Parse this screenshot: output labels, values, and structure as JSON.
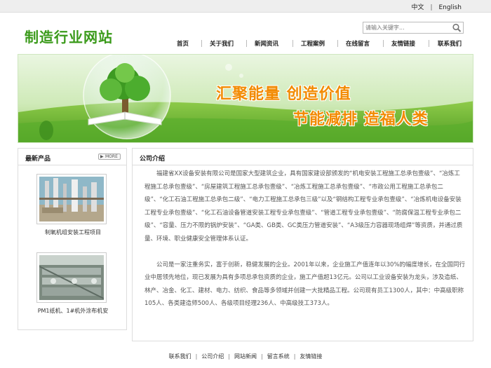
{
  "lang": {
    "chinese": "中文",
    "separator": "|",
    "english": "English"
  },
  "logo": "制造行业网站",
  "search": {
    "placeholder": "请输入关键字..."
  },
  "nav": [
    "首页",
    "关于我们",
    "新闻资讯",
    "工程案例",
    "在线留言",
    "友情链接",
    "联系我们"
  ],
  "banner": {
    "slogan1": "汇聚能量 创造价值",
    "slogan2": "节能减排 造福人类"
  },
  "products": {
    "title": "最新产品",
    "more": "MORE",
    "items": [
      {
        "name": "制氧机组安装工程项目"
      },
      {
        "name": "PM1纸机、1#机外涂布机安"
      }
    ]
  },
  "about": {
    "title": "公司介绍",
    "paragraphs": [
      "福建省XX设备安装有限公司是国家大型建筑企业，具有国家建设部颁发的“机电安装工程施工总承包壹级”、“冶炼工程施工总承包壹级”、“房屋建筑工程施工总承包壹级”、“冶炼工程施工总承包壹级”、“市政公用工程施工总承包二级”、“化工石油工程施工总承包二级”、“电力工程施工总承包三级”以及“钢结构工程专业承包壹级”、“冶炼机电设备安装工程专业承包壹级”、“化工石油设备管道安装工程专业承包壹级”、“管道工程专业承包壹级”、“防腐保温工程专业承包二级”、“容量、压力不限的锅炉安装”、“GA类、GB类、GC类压力管道安装”、“A3级压力容器现场组焊”等资质，并通过质量、环境、职业健康安全管理体系认证。",
      "公司是一家注重务实，富于创新，稳健发展的企业。2001年以来，企业施工产值连年以30%的幅度增长，在全国同行业中居领先地位，现已发展为具有多项总承包资质的企业，施工产值超13亿元。公司以工业设备安装为龙头，涉及造纸、林产、冶金、化工、建材、电力、纺织、食品等多领域并创建一大批精品工程。公司现有员工1300人，其中：中高级职称105人、各类建造师500人、各级项目经理236人、中高级技工373人。"
    ]
  },
  "footer": [
    "联系我们",
    "公司介绍",
    "网站新闻",
    "留言系统",
    "友情链接"
  ],
  "footer_separator": "|",
  "colors": {
    "logo_green": "#3a9a1a",
    "slogan_orange": "#f28a00",
    "grass_green": "#5aae2c",
    "topbar_gray": "#eeeeee"
  },
  "icons": {
    "search_button": "magnifier-icon",
    "more_button": "circle-arrow-icon"
  }
}
